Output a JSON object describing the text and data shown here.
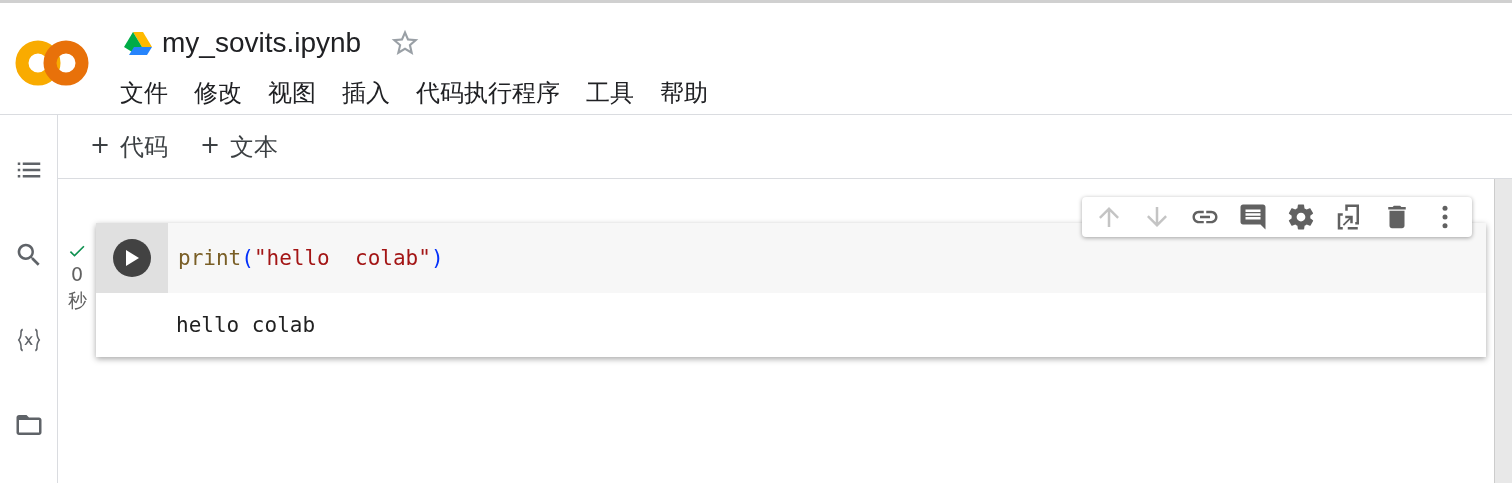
{
  "notebook": {
    "title": "my_sovits.ipynb",
    "starred": false
  },
  "menu": [
    "文件",
    "修改",
    "视图",
    "插入",
    "代码执行程序",
    "工具",
    "帮助"
  ],
  "insert_buttons": [
    {
      "icon": "+",
      "label": "代码"
    },
    {
      "icon": "+",
      "label": "文本"
    }
  ],
  "cell": {
    "status": {
      "done": true,
      "time": "0",
      "unit": "秒"
    },
    "code": [
      {
        "kind": "builtin",
        "text": "print"
      },
      {
        "kind": "bracket",
        "text": "("
      },
      {
        "kind": "string",
        "text": "\"hello  colab\""
      },
      {
        "kind": "bracket",
        "text": ")"
      }
    ],
    "output": "hello colab",
    "toolbar": [
      {
        "kind": "up",
        "disabled": true
      },
      {
        "kind": "down",
        "disabled": true
      },
      {
        "kind": "link",
        "disabled": false
      },
      {
        "kind": "comment",
        "disabled": false
      },
      {
        "kind": "settings",
        "disabled": false
      },
      {
        "kind": "mirror",
        "disabled": false
      },
      {
        "kind": "delete",
        "disabled": false
      },
      {
        "kind": "more",
        "disabled": false
      }
    ]
  }
}
